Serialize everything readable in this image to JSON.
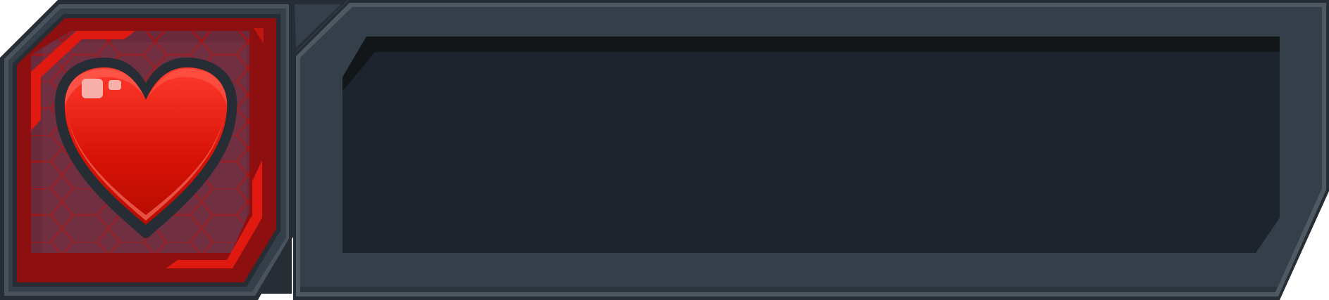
{
  "hud": {
    "icon_panel": {
      "icon": "heart-icon",
      "frame_color": "#8e0f0f",
      "accent_color": "#e01a10",
      "hex_grid": "hexagon-pattern"
    },
    "bar_panel": {
      "frame_color": "#353f49",
      "inner_color": "#1d242d",
      "fill_level": 0
    }
  },
  "colors": {
    "outline": "#262d35",
    "bevel_light": "#5a636c",
    "heart_red": "#df1206",
    "heart_highlight": "#f05a4e"
  }
}
